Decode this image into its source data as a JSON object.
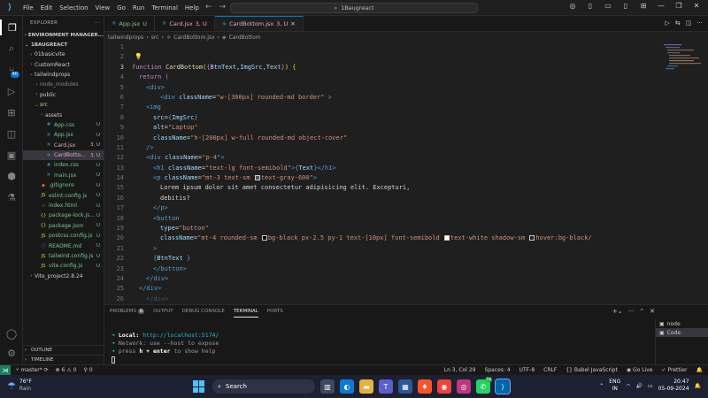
{
  "titlebar": {
    "menu": [
      "File",
      "Edit",
      "Selection",
      "View",
      "Go",
      "Run",
      "Terminal",
      "Help"
    ],
    "search": "1Baugreact"
  },
  "activity": {
    "source_control_badge": "40"
  },
  "sidebar": {
    "explorer_label": "EXPLORER",
    "env_manager": "ENVIRONMENT MANAGER...",
    "root": "1BAUGREACT",
    "items": [
      {
        "label": "01basicvite",
        "indent": 1,
        "type": "folder",
        "open": false,
        "status": "",
        "color": "#cccccc"
      },
      {
        "label": "CustomReact",
        "indent": 1,
        "type": "folder",
        "open": false,
        "status": "",
        "color": "#cccccc"
      },
      {
        "label": "tailwindprops",
        "indent": 1,
        "type": "folder",
        "open": true,
        "status": "",
        "color": "#cccccc"
      },
      {
        "label": "node_modules",
        "indent": 2,
        "type": "folder",
        "open": false,
        "status": "",
        "color": "#8b8b8b"
      },
      {
        "label": "public",
        "indent": 2,
        "type": "folder",
        "open": false,
        "status": "",
        "color": "#cccccc"
      },
      {
        "label": "src",
        "indent": 2,
        "type": "folder",
        "open": true,
        "status": "",
        "color": "#e2c08d"
      },
      {
        "label": "assets",
        "indent": 3,
        "type": "folder",
        "open": false,
        "status": "",
        "color": "#cccccc"
      },
      {
        "label": "App.css",
        "indent": 3,
        "type": "css",
        "open": false,
        "status": "U",
        "color": "#73c991"
      },
      {
        "label": "App.jsx",
        "indent": 3,
        "type": "react",
        "open": false,
        "status": "U",
        "color": "#73c991"
      },
      {
        "label": "Card.jsx",
        "indent": 3,
        "type": "react",
        "open": false,
        "status": "3, U",
        "color": "#e8a7c3"
      },
      {
        "label": "CardBotto...",
        "indent": 3,
        "type": "react",
        "open": false,
        "status": "3, U",
        "color": "#e8a7c3",
        "selected": true
      },
      {
        "label": "index.css",
        "indent": 3,
        "type": "css",
        "open": false,
        "status": "U",
        "color": "#73c991"
      },
      {
        "label": "main.jsx",
        "indent": 3,
        "type": "react",
        "open": false,
        "status": "U",
        "color": "#73c991"
      },
      {
        "label": ".gitignore",
        "indent": 2,
        "type": "git",
        "open": false,
        "status": "U",
        "color": "#73c991"
      },
      {
        "label": "eslint.config.js",
        "indent": 2,
        "type": "js",
        "open": false,
        "status": "U",
        "color": "#73c991"
      },
      {
        "label": "index.html",
        "indent": 2,
        "type": "html",
        "open": false,
        "status": "U",
        "color": "#73c991"
      },
      {
        "label": "package-lock.js...",
        "indent": 2,
        "type": "json",
        "open": false,
        "status": "U",
        "color": "#73c991"
      },
      {
        "label": "package.json",
        "indent": 2,
        "type": "json",
        "open": false,
        "status": "U",
        "color": "#73c991"
      },
      {
        "label": "postcss.config.js",
        "indent": 2,
        "type": "js",
        "open": false,
        "status": "U",
        "color": "#73c991"
      },
      {
        "label": "README.md",
        "indent": 2,
        "type": "md",
        "open": false,
        "status": "U",
        "color": "#73c991"
      },
      {
        "label": "tailwind.config.js",
        "indent": 2,
        "type": "js",
        "open": false,
        "status": "U",
        "color": "#73c991"
      },
      {
        "label": "vite.config.js",
        "indent": 2,
        "type": "js",
        "open": false,
        "status": "U",
        "color": "#73c991"
      },
      {
        "label": "Vite_project2.8.24",
        "indent": 1,
        "type": "folder",
        "open": false,
        "status": "",
        "color": "#cccccc"
      }
    ],
    "outline": "OUTLINE",
    "timeline": "TIMELINE"
  },
  "tabs": [
    {
      "label": "App.jsx",
      "status": "U",
      "active": false
    },
    {
      "label": "Card.jsx",
      "status": "3, U",
      "active": false
    },
    {
      "label": "CardBottom.jsx",
      "status": "3, U",
      "active": true
    }
  ],
  "breadcrumb": [
    "tailwindprops",
    "src",
    "CardBottom.jsx",
    "CardBottom"
  ],
  "code": {
    "current_line": 3,
    "start_line": 1
  },
  "panel": {
    "tabs": [
      {
        "label": "PROBLEMS",
        "badge": "6",
        "active": false
      },
      {
        "label": "OUTPUT",
        "badge": "",
        "active": false
      },
      {
        "label": "DEBUG CONSOLE",
        "badge": "",
        "active": false
      },
      {
        "label": "TERMINAL",
        "badge": "",
        "active": true
      },
      {
        "label": "PORTS",
        "badge": "",
        "active": false
      }
    ],
    "terminal": {
      "local_label": "Local:",
      "local_url": "http://localhost:5174/",
      "network_line": "Network: use --host to expose",
      "help_pre": "press ",
      "help_key": "h + enter",
      "help_post": " to show help"
    },
    "terminals": [
      {
        "label": "node",
        "active": false
      },
      {
        "label": "Code",
        "active": true
      }
    ]
  },
  "statusbar": {
    "branch": "master*",
    "errors": "6",
    "warnings": "0",
    "ports": "0",
    "position": "Ln 3, Col 29",
    "spaces": "Spaces: 4",
    "encoding": "UTF-8",
    "eol": "CRLF",
    "language": "Babel JavaScript",
    "golive": "Go Live",
    "prettier": "Prettier"
  },
  "taskbar": {
    "temp": "76°F",
    "weather": "Rain",
    "search": "Search",
    "lang1": "ENG",
    "lang2": "IN",
    "time": "20:47",
    "date": "05-09-2024",
    "whatsapp_badge": "74"
  }
}
